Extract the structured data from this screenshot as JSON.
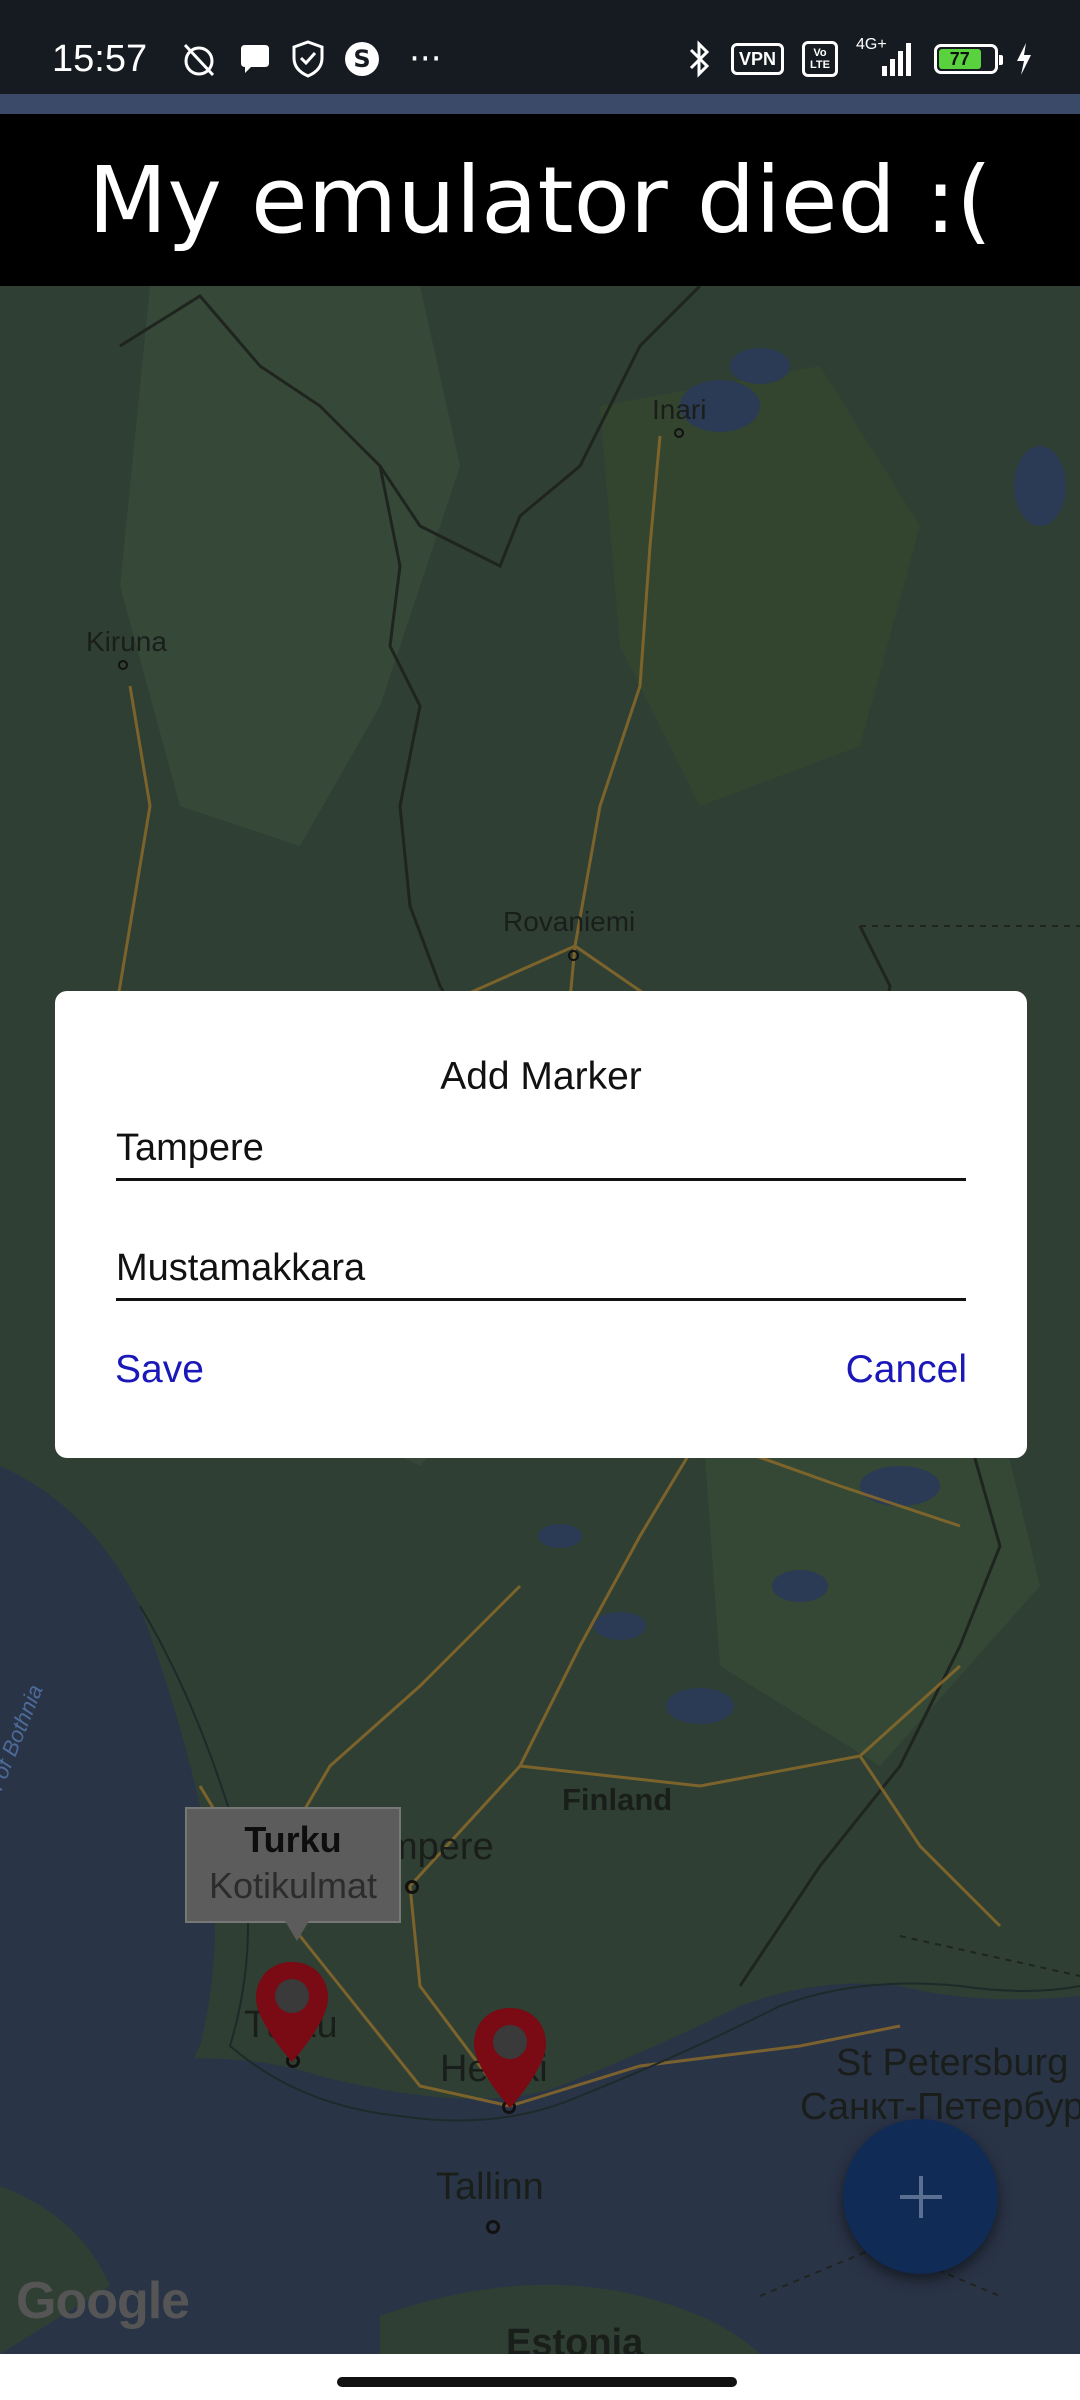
{
  "status_bar": {
    "time": "15:57",
    "vpn_label": "VPN",
    "volte_label": "Vo LTE",
    "network_label": "4G+",
    "battery_level": "77",
    "overflow": "···"
  },
  "banner": {
    "text": "My emulator died :("
  },
  "map": {
    "labels": {
      "inari": "Inari",
      "kiruna": "Kiruna",
      "rovaniemi": "Rovaniemi",
      "finland": "Finland",
      "tampere_partial": "mpere",
      "turku_partial": "Tu    ku",
      "helsinki_partial": "He      nki",
      "tallinn": "Tallinn",
      "st_petersburg": "St Petersburg",
      "st_petersburg_ru": "Санкт-Петербург",
      "estonia": "Estonia",
      "gulf_of_bothnia": "Gulf of Bothnia"
    },
    "info_window": {
      "title": "Turku",
      "snippet": "Kotikulmat"
    },
    "google_logo": "Google",
    "marker_color": "#7a0a14"
  },
  "dialog": {
    "title": "Add Marker",
    "name_value": "Tampere",
    "snippet_value": "Mustamakkara",
    "save_label": "Save",
    "cancel_label": "Cancel",
    "button_color": "#1a18b8"
  },
  "fab": {
    "icon": "plus-icon"
  }
}
